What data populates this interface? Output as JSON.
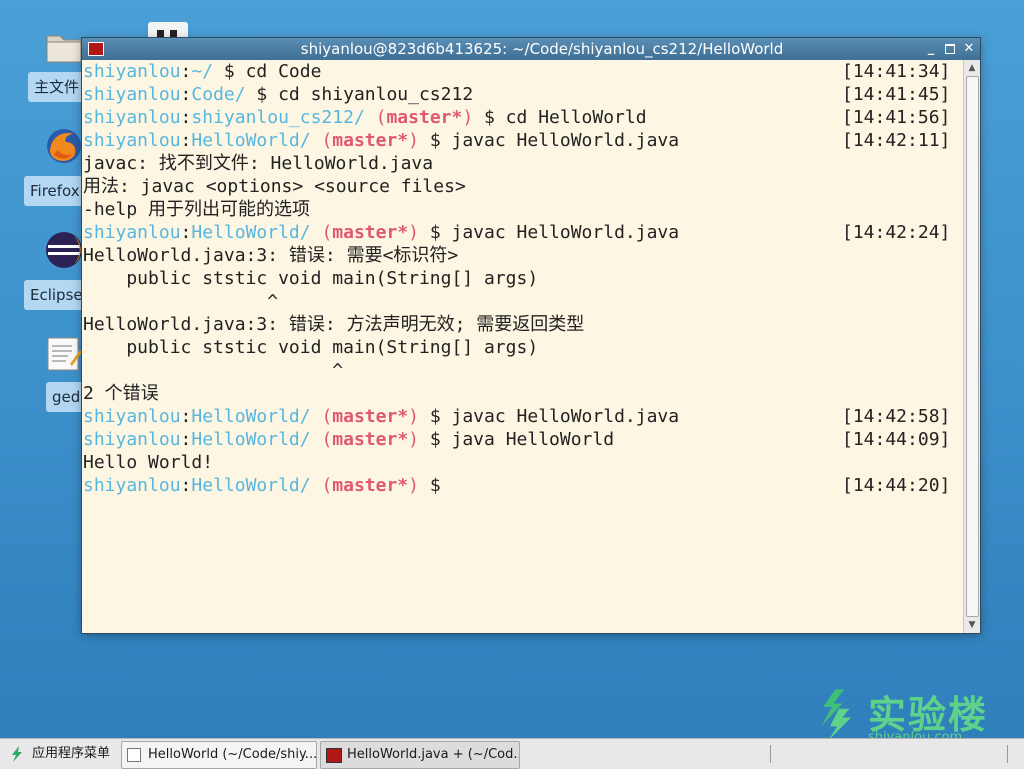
{
  "desktop": {
    "icons": [
      {
        "label": "主文件",
        "icon": "folder-icon"
      },
      {
        "label": "Firefox",
        "icon": "firefox-icon"
      },
      {
        "label": "Eclipse",
        "icon": "eclipse-icon"
      },
      {
        "label": "gedi",
        "icon": "gedit-icon"
      }
    ]
  },
  "window": {
    "title": "shiyanlou@823d6b413625: ~/Code/shiyanlou_cs212/HelloWorld",
    "minimize": "_",
    "close": "✕"
  },
  "terminal": {
    "lines": [
      {
        "type": "prompt",
        "user": "shiyanlou",
        "path": "~/",
        "branch": "",
        "cmd": " $ cd Code",
        "time": "[14:41:34]"
      },
      {
        "type": "prompt",
        "user": "shiyanlou",
        "path": "Code/",
        "branch": "",
        "cmd": " $ cd shiyanlou_cs212",
        "time": "[14:41:45]"
      },
      {
        "type": "prompt",
        "user": "shiyanlou",
        "path": "shiyanlou_cs212/",
        "branch": "master*",
        "cmd": " $ cd HelloWorld",
        "time": "[14:41:56]"
      },
      {
        "type": "prompt",
        "user": "shiyanlou",
        "path": "HelloWorld/",
        "branch": "master*",
        "cmd": " $ javac HelloWorld.java",
        "time": "[14:42:11]"
      },
      {
        "type": "out",
        "text": "javac: 找不到文件: HelloWorld.java"
      },
      {
        "type": "out",
        "text": "用法: javac <options> <source files>"
      },
      {
        "type": "out",
        "text": "-help 用于列出可能的选项"
      },
      {
        "type": "prompt",
        "user": "shiyanlou",
        "path": "HelloWorld/",
        "branch": "master*",
        "cmd": " $ javac HelloWorld.java",
        "time": "[14:42:24]"
      },
      {
        "type": "out",
        "text": "HelloWorld.java:3: 错误: 需要<标识符>"
      },
      {
        "type": "out",
        "text": "    public ststic void main(String[] args)"
      },
      {
        "type": "out",
        "text": "                 ^"
      },
      {
        "type": "out",
        "text": "HelloWorld.java:3: 错误: 方法声明无效; 需要返回类型"
      },
      {
        "type": "out",
        "text": "    public ststic void main(String[] args)"
      },
      {
        "type": "out",
        "text": "                       ^"
      },
      {
        "type": "out",
        "text": "2 个错误"
      },
      {
        "type": "prompt",
        "user": "shiyanlou",
        "path": "HelloWorld/",
        "branch": "master*",
        "cmd": " $ javac HelloWorld.java",
        "time": "[14:42:58]"
      },
      {
        "type": "prompt",
        "user": "shiyanlou",
        "path": "HelloWorld/",
        "branch": "master*",
        "cmd": " $ java HelloWorld",
        "time": "[14:44:09]"
      },
      {
        "type": "out",
        "text": "Hello World!"
      },
      {
        "type": "prompt",
        "user": "shiyanlou",
        "path": "HelloWorld/",
        "branch": "master*",
        "cmd": " $",
        "time": "[14:44:20]"
      }
    ]
  },
  "brand": {
    "name": "实验楼",
    "url": "shiyanlou.com"
  },
  "taskbar": {
    "start_label": "应用程序菜单",
    "tasks": [
      {
        "label": "HelloWorld (~/Code/shiy..."
      },
      {
        "label": "HelloWorld.java + (~/Cod..."
      }
    ]
  },
  "colors": {
    "user": "#56b6e0",
    "branch": "#e0586e",
    "terminal_bg": "#fdf6e3"
  }
}
